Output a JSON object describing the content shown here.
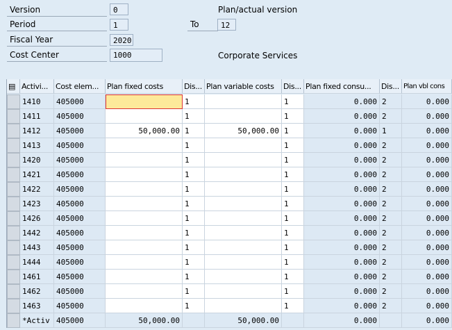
{
  "header": {
    "version_label": "Version",
    "version_value": "0",
    "version_desc": "Plan/actual version",
    "period_label": "Period",
    "period_from": "1",
    "to_label": "To",
    "period_to": "12",
    "fiscal_year_label": "Fiscal Year",
    "fiscal_year_value": "2020",
    "cost_center_label": "Cost Center",
    "cost_center_value": "1000",
    "cost_center_desc": "Corporate Services"
  },
  "table": {
    "columns": [
      "Activi...",
      "Cost elem...",
      "Plan fixed costs",
      "Dis...",
      "Plan variable costs",
      "Dis...",
      "Plan fixed consu...",
      "Dis...",
      "Plan vbl cons"
    ],
    "rows": [
      [
        "1410",
        "405000",
        "",
        "1",
        "",
        "1",
        "0.000",
        "2",
        "0.000"
      ],
      [
        "1411",
        "405000",
        "",
        "1",
        "",
        "1",
        "0.000",
        "2",
        "0.000"
      ],
      [
        "1412",
        "405000",
        "50,000.00",
        "1",
        "50,000.00",
        "1",
        "0.000",
        "1",
        "0.000"
      ],
      [
        "1413",
        "405000",
        "",
        "1",
        "",
        "1",
        "0.000",
        "2",
        "0.000"
      ],
      [
        "1420",
        "405000",
        "",
        "1",
        "",
        "1",
        "0.000",
        "2",
        "0.000"
      ],
      [
        "1421",
        "405000",
        "",
        "1",
        "",
        "1",
        "0.000",
        "2",
        "0.000"
      ],
      [
        "1422",
        "405000",
        "",
        "1",
        "",
        "1",
        "0.000",
        "2",
        "0.000"
      ],
      [
        "1423",
        "405000",
        "",
        "1",
        "",
        "1",
        "0.000",
        "2",
        "0.000"
      ],
      [
        "1426",
        "405000",
        "",
        "1",
        "",
        "1",
        "0.000",
        "2",
        "0.000"
      ],
      [
        "1442",
        "405000",
        "",
        "1",
        "",
        "1",
        "0.000",
        "2",
        "0.000"
      ],
      [
        "1443",
        "405000",
        "",
        "1",
        "",
        "1",
        "0.000",
        "2",
        "0.000"
      ],
      [
        "1444",
        "405000",
        "",
        "1",
        "",
        "1",
        "0.000",
        "2",
        "0.000"
      ],
      [
        "1461",
        "405000",
        "",
        "1",
        "",
        "1",
        "0.000",
        "2",
        "0.000"
      ],
      [
        "1462",
        "405000",
        "",
        "1",
        "",
        "1",
        "0.000",
        "2",
        "0.000"
      ],
      [
        "1463",
        "405000",
        "",
        "1",
        "",
        "1",
        "0.000",
        "2",
        "0.000"
      ]
    ],
    "total": [
      "*Activ",
      "405000",
      "50,000.00",
      "",
      "50,000.00",
      "",
      "0.000",
      "",
      "0.000"
    ]
  }
}
